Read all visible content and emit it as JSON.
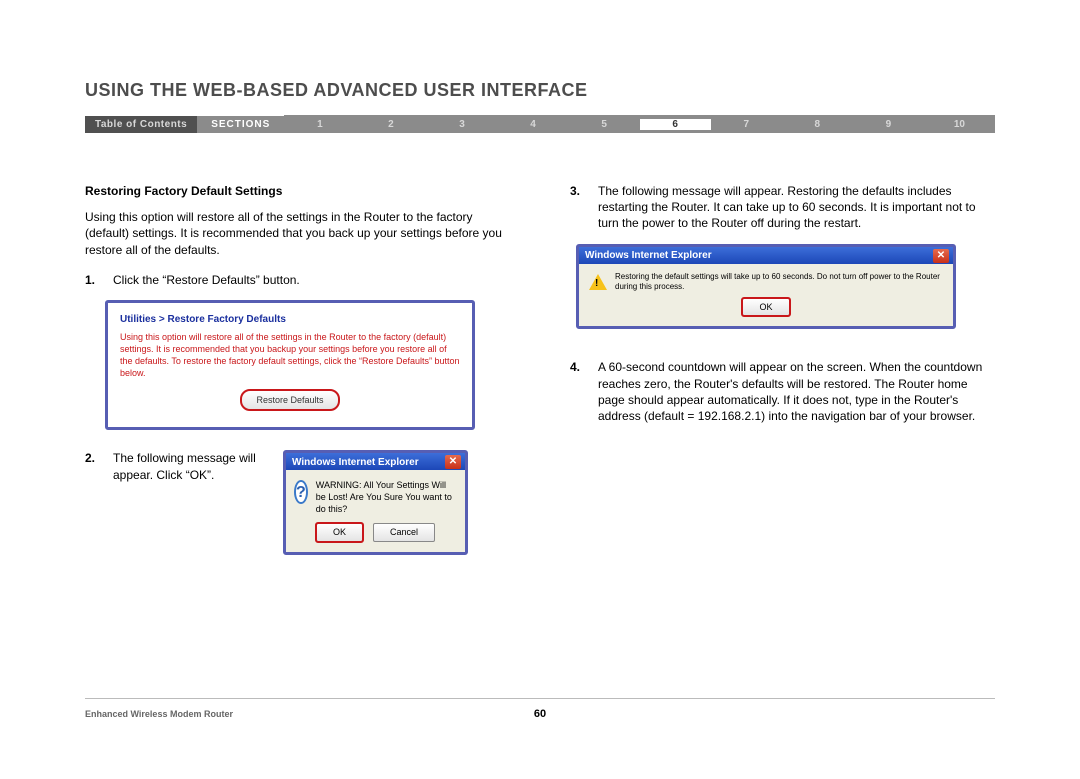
{
  "page_title": "USING THE WEB-BASED ADVANCED USER INTERFACE",
  "nav": {
    "toc": "Table of Contents",
    "sections_label": "SECTIONS",
    "nums": [
      "1",
      "2",
      "3",
      "4",
      "5",
      "6",
      "7",
      "8",
      "9",
      "10"
    ],
    "active": "6"
  },
  "left": {
    "heading": "Restoring Factory Default Settings",
    "intro": "Using this option will restore all of the settings in the Router to the factory (default) settings. It is recommended that you back up your settings before you restore all of the defaults.",
    "step1_num": "1.",
    "step1_text": "Click the “Restore Defaults” button.",
    "panel_title": "Utilities > Restore Factory Defaults",
    "panel_body": "Using this option will restore all of the settings in the Router to the factory (default) settings. It is recommended that you backup your settings before you restore all of the defaults. To restore the factory default settings, click the “Restore Defaults” button below.",
    "restore_btn": "Restore Defaults",
    "step2_num": "2.",
    "step2_text": "The following message will appear. Click “OK”.",
    "dialog_title": "Windows Internet Explorer",
    "dialog_msg": "WARNING: All Your Settings Will be Lost! Are You Sure You want to do this?",
    "ok": "OK",
    "cancel": "Cancel"
  },
  "right": {
    "step3_num": "3.",
    "step3_text": "The following message will appear. Restoring the defaults includes restarting the Router. It can take up to 60 seconds. It is important not to turn the power to the Router off during the restart.",
    "dialog2_title": "Windows Internet Explorer",
    "dialog2_msg": "Restoring the default settings will take up to 60 seconds. Do not turn off power to the Router during this process.",
    "ok2": "OK",
    "step4_num": "4.",
    "step4_text": "A 60-second countdown will appear on the screen. When the countdown reaches zero, the Router's defaults will be restored. The Router home page should appear automatically. If it does not, type in the Router's address (default = 192.168.2.1) into the navigation bar of your browser."
  },
  "footer": {
    "product": "Enhanced Wireless Modem Router",
    "page": "60"
  }
}
